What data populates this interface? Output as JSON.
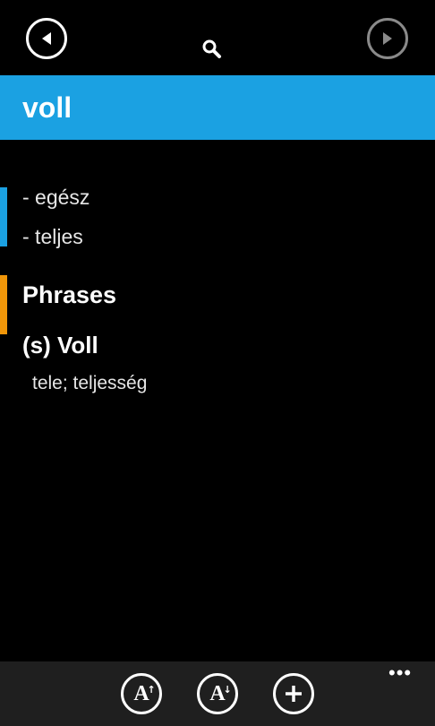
{
  "nav": {
    "back_icon": "back-arrow-icon",
    "forward_icon": "forward-arrow-icon",
    "search_icon": "search-icon"
  },
  "header": {
    "title": "voll",
    "accent_color": "#1ba1e2"
  },
  "meanings": [
    {
      "label": "- egész"
    },
    {
      "label": "- teljes"
    }
  ],
  "phrases": {
    "heading": "Phrases",
    "accent_color": "#f09609",
    "items": [
      {
        "title": "(s) Voll",
        "translation": "tele; teljesség"
      }
    ]
  },
  "appbar": {
    "buttons": [
      {
        "icon": "increase-font-icon",
        "glyph": "A",
        "arrow": "↑"
      },
      {
        "icon": "decrease-font-icon",
        "glyph": "A",
        "arrow": "↓"
      },
      {
        "icon": "add-icon",
        "glyph": "+"
      }
    ],
    "more": "•••"
  }
}
